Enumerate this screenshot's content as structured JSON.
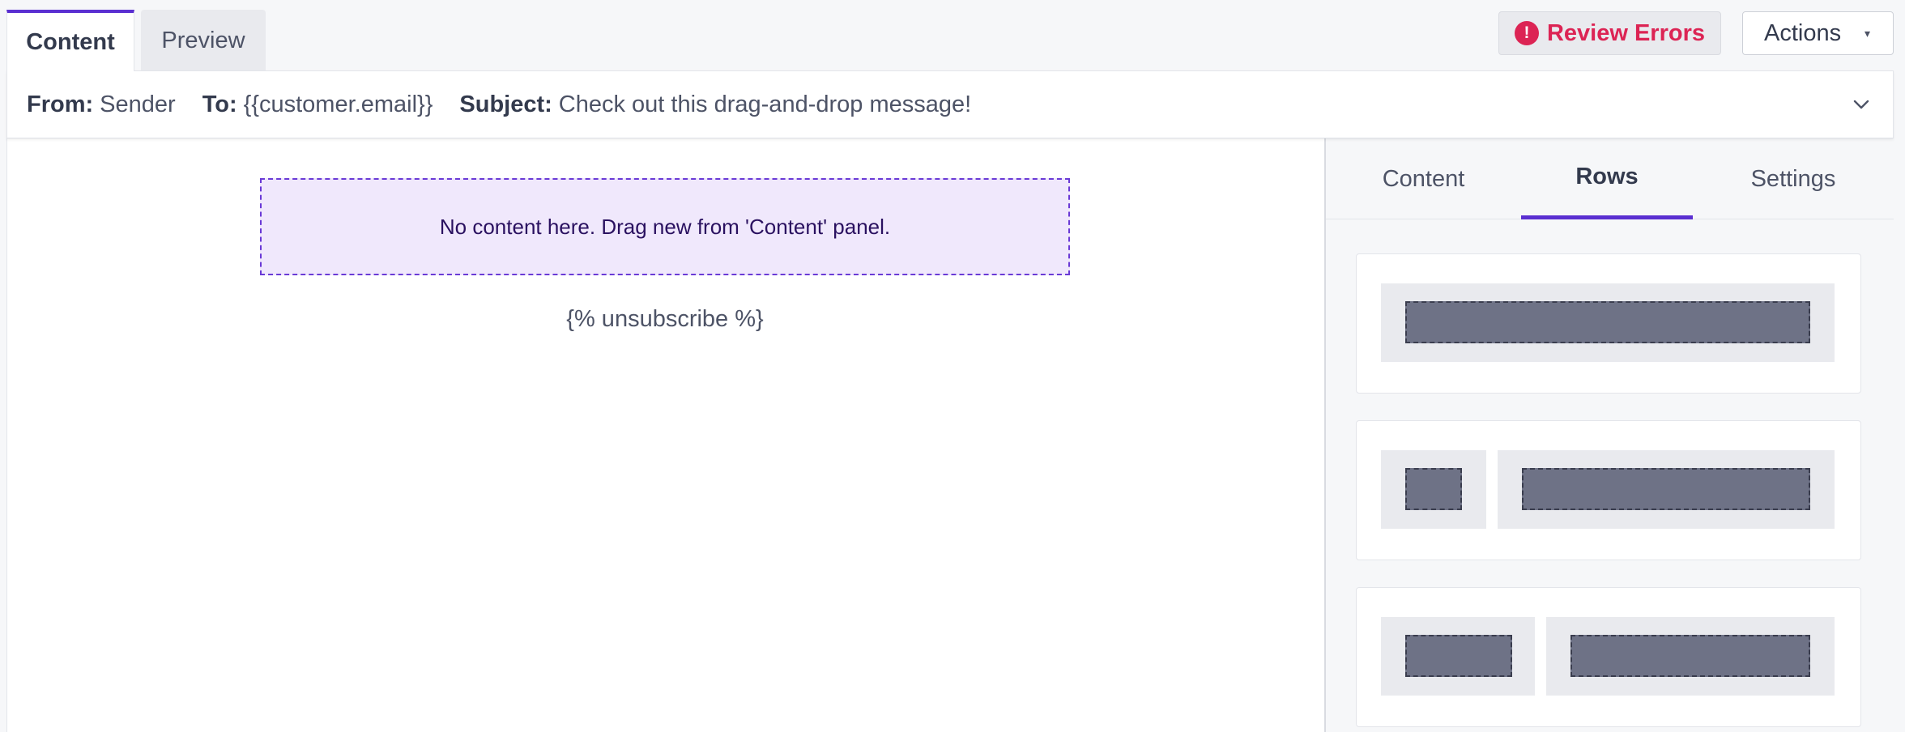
{
  "top_tabs": [
    {
      "label": "Content",
      "active": true
    },
    {
      "label": "Preview",
      "active": false
    }
  ],
  "review_errors": {
    "label": "Review Errors",
    "icon": "exclamation-icon",
    "icon_glyph": "!",
    "color": "#dc2454"
  },
  "actions": {
    "label": "Actions",
    "caret": "▾"
  },
  "header": {
    "from_label": "From:",
    "from_value": "Sender",
    "to_label": "To:",
    "to_value": "{{customer.email}}",
    "subject_label": "Subject:",
    "subject_value": "Check out this drag-and-drop message!"
  },
  "canvas": {
    "placeholder": "No content here. Drag new from 'Content' panel.",
    "unsubscribe": "{% unsubscribe %}"
  },
  "panel": {
    "tabs": [
      {
        "label": "Content",
        "active": false
      },
      {
        "label": "Rows",
        "active": true
      },
      {
        "label": "Settings",
        "active": false
      }
    ],
    "row_layouts": [
      {
        "name": "one-column"
      },
      {
        "name": "small-left-wide-right"
      },
      {
        "name": "two-columns"
      }
    ]
  },
  "colors": {
    "accent": "#5a2fd1",
    "error": "#dc2454",
    "dropzone_bg": "#f0e8fc",
    "block": "#6e7286"
  }
}
